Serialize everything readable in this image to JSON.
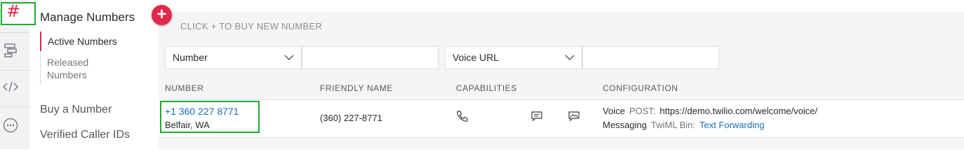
{
  "rail": {
    "icons": [
      "hash-icon",
      "flow-icon",
      "code-icon",
      "more-icon"
    ]
  },
  "sidebar": {
    "title": "Manage Numbers",
    "items": [
      {
        "label": "Active Numbers",
        "active": true
      },
      {
        "label": "Released Numbers",
        "active": false
      }
    ],
    "links": [
      "Buy a Number",
      "Verified Caller IDs"
    ]
  },
  "main": {
    "buy_hint": "CLICK + TO BUY NEW NUMBER",
    "filters": [
      {
        "selected": "Number",
        "value": ""
      },
      {
        "selected": "Voice URL",
        "value": ""
      }
    ],
    "columns": [
      "NUMBER",
      "FRIENDLY NAME",
      "CAPABILITIES",
      "CONFIGURATION"
    ],
    "rows": [
      {
        "number": "+1 360 227 8771",
        "location": "Belfair, WA",
        "friendly_name": "(360) 227-8771",
        "capabilities": [
          "phone-icon",
          "sms-icon",
          "mms-icon"
        ],
        "config": {
          "voice_label": "Voice",
          "voice_method": "POST:",
          "voice_url": "https://demo.twilio.com/welcome/voice/",
          "messaging_label": "Messaging",
          "messaging_type": "TwiML Bin:",
          "messaging_link": "Text Forwarding"
        }
      }
    ]
  },
  "colors": {
    "accent": "#e5264b",
    "link": "#1a6db8",
    "highlight": "#1faa2e"
  }
}
